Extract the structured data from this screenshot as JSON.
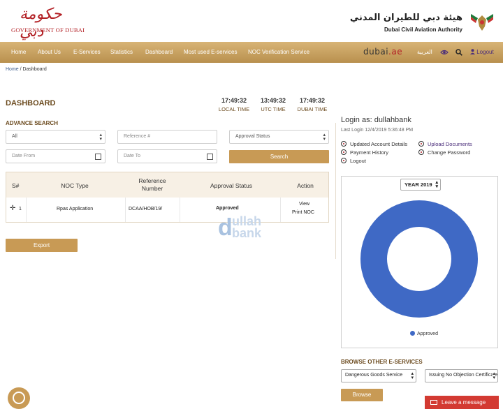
{
  "header": {
    "gov_arabic": "حكومة دبي",
    "gov_english": "GOVERNMENT OF DUBAI",
    "dcaa_arabic": "هيئة دبي للطيران المدني",
    "dcaa_english": "Dubai Civil Aviation Authority"
  },
  "nav": {
    "items": [
      "Home",
      "About Us",
      "E-Services",
      "Statistics",
      "Dashboard",
      "Most used E-services",
      "NOC Verification Service"
    ],
    "portal_main": "dubai",
    "portal_tld": ".ae",
    "arabic": "العربية",
    "logout": "Logout",
    "icons": [
      "eye-icon",
      "search-icon",
      "user-icon"
    ]
  },
  "breadcrumb": {
    "home": "Home",
    "sep": " / ",
    "current": "Dashboard"
  },
  "dashboard": {
    "title": "DASHBOARD",
    "clocks": [
      {
        "time": "17:49:32",
        "label": "LOCAL TIME"
      },
      {
        "time": "13:49:32",
        "label": "UTC TIME"
      },
      {
        "time": "17:49:32",
        "label": "DUBAI TIME"
      }
    ]
  },
  "search": {
    "title": "ADVANCE SEARCH",
    "type_value": "All",
    "ref_placeholder": "Reference #",
    "status_value": "Approval Status",
    "date_from_placeholder": "Date From",
    "date_to_placeholder": "Date To",
    "search_button": "Search"
  },
  "table": {
    "headers": [
      "S#",
      "NOC Type",
      "Reference Number",
      "Approval Status",
      "Action"
    ],
    "rows": [
      {
        "expand": "✛",
        "sn": "1",
        "noc_type": "Rpas Application",
        "ref": "DCAA/HOB/19/",
        "status": "Approved",
        "view": "View",
        "print": "Print NOC"
      }
    ]
  },
  "watermark": {
    "letter": "d",
    "top": "ullah",
    "bottom": "bank"
  },
  "export_button": "Export",
  "account": {
    "login_label": "Login as: ",
    "username": "dullahbank",
    "last_login": "Last Login 12/4/2019 5:36:48 PM",
    "links": [
      "Updated Account Details",
      "Upload Documents",
      "Payment History",
      "Change Password",
      "Logout"
    ]
  },
  "chart_data": {
    "type": "pie",
    "year_select": "YEAR 2019",
    "categories": [
      "Approved"
    ],
    "values": [
      1
    ],
    "colors": [
      "#3f69c5"
    ],
    "legend_position": "bottom"
  },
  "browse": {
    "title": "BROWSE OTHER E-SERVICES",
    "service_select": "Dangerous Goods Service",
    "cert_select": "Issuing No Objection Certificate",
    "button": "Browse"
  },
  "chat": {
    "leave_message": "Leave a message"
  },
  "colors": {
    "gold": "#c89a55",
    "brown": "#6b4a1e",
    "approved": "#3a8a3a",
    "red": "#d33a32",
    "chart_blue": "#3f69c5"
  }
}
